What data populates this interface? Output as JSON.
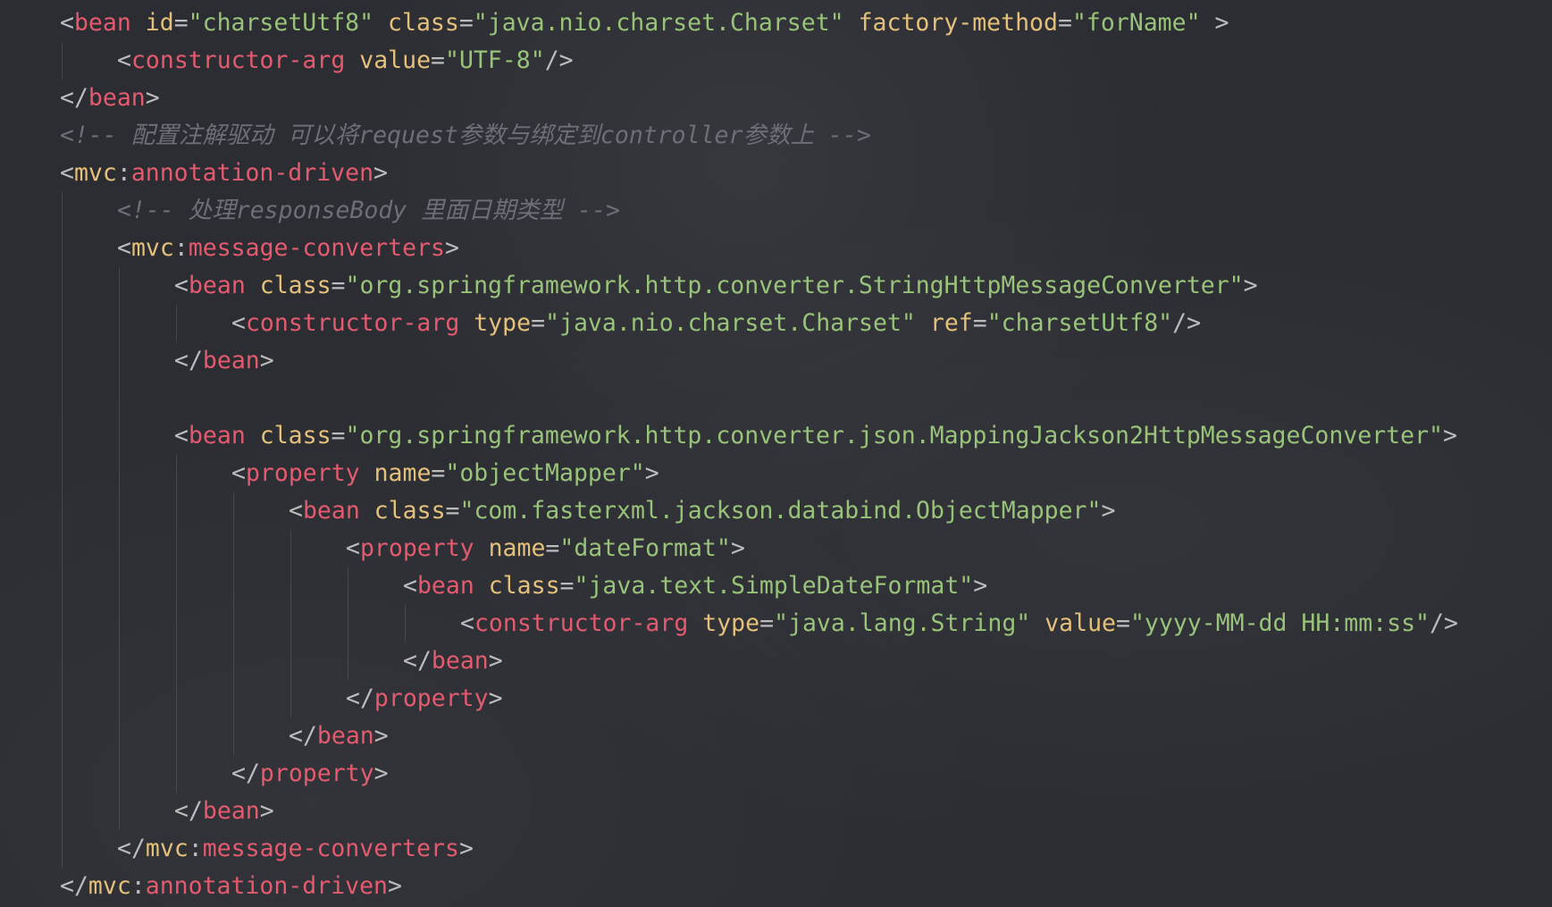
{
  "lines": [
    {
      "indent": 0,
      "tokens": [
        {
          "t": "bracket",
          "v": "<"
        },
        {
          "t": "tag",
          "v": "bean"
        },
        {
          "t": "text",
          "v": " "
        },
        {
          "t": "attr",
          "v": "id"
        },
        {
          "t": "eq",
          "v": "="
        },
        {
          "t": "value",
          "v": "\"charsetUtf8\""
        },
        {
          "t": "text",
          "v": " "
        },
        {
          "t": "attr",
          "v": "class"
        },
        {
          "t": "eq",
          "v": "="
        },
        {
          "t": "value",
          "v": "\"java.nio.charset.Charset\""
        },
        {
          "t": "text",
          "v": " "
        },
        {
          "t": "attr",
          "v": "factory-method"
        },
        {
          "t": "eq",
          "v": "="
        },
        {
          "t": "value",
          "v": "\"forName\""
        },
        {
          "t": "text",
          "v": " "
        },
        {
          "t": "bracket",
          "v": ">"
        }
      ]
    },
    {
      "indent": 1,
      "tokens": [
        {
          "t": "bracket",
          "v": "<"
        },
        {
          "t": "tag",
          "v": "constructor-arg"
        },
        {
          "t": "text",
          "v": " "
        },
        {
          "t": "attr",
          "v": "value"
        },
        {
          "t": "eq",
          "v": "="
        },
        {
          "t": "value",
          "v": "\"UTF-8\""
        },
        {
          "t": "bracket",
          "v": "/>"
        }
      ]
    },
    {
      "indent": 0,
      "tokens": [
        {
          "t": "bracket",
          "v": "</"
        },
        {
          "t": "tag",
          "v": "bean"
        },
        {
          "t": "bracket",
          "v": ">"
        }
      ]
    },
    {
      "indent": 0,
      "tokens": [
        {
          "t": "comment",
          "v": "<!-- 配置注解驱动 可以将request参数与绑定到controller参数上 -->"
        }
      ]
    },
    {
      "indent": 0,
      "tokens": [
        {
          "t": "bracket",
          "v": "<"
        },
        {
          "t": "ns",
          "v": "mvc"
        },
        {
          "t": "bracket",
          "v": ":"
        },
        {
          "t": "tag",
          "v": "annotation-driven"
        },
        {
          "t": "bracket",
          "v": ">"
        }
      ]
    },
    {
      "indent": 1,
      "tokens": [
        {
          "t": "comment",
          "v": "<!-- 处理responseBody 里面日期类型 -->"
        }
      ]
    },
    {
      "indent": 1,
      "tokens": [
        {
          "t": "bracket",
          "v": "<"
        },
        {
          "t": "ns",
          "v": "mvc"
        },
        {
          "t": "bracket",
          "v": ":"
        },
        {
          "t": "tag",
          "v": "message-converters"
        },
        {
          "t": "bracket",
          "v": ">"
        }
      ]
    },
    {
      "indent": 2,
      "tokens": [
        {
          "t": "bracket",
          "v": "<"
        },
        {
          "t": "tag",
          "v": "bean"
        },
        {
          "t": "text",
          "v": " "
        },
        {
          "t": "attr",
          "v": "class"
        },
        {
          "t": "eq",
          "v": "="
        },
        {
          "t": "value",
          "v": "\"org.springframework.http.converter.StringHttpMessageConverter\""
        },
        {
          "t": "bracket",
          "v": ">"
        }
      ]
    },
    {
      "indent": 3,
      "tokens": [
        {
          "t": "bracket",
          "v": "<"
        },
        {
          "t": "tag",
          "v": "constructor-arg"
        },
        {
          "t": "text",
          "v": " "
        },
        {
          "t": "attr",
          "v": "type"
        },
        {
          "t": "eq",
          "v": "="
        },
        {
          "t": "value",
          "v": "\"java.nio.charset.Charset\""
        },
        {
          "t": "text",
          "v": " "
        },
        {
          "t": "attr",
          "v": "ref"
        },
        {
          "t": "eq",
          "v": "="
        },
        {
          "t": "value",
          "v": "\"charsetUtf8\""
        },
        {
          "t": "bracket",
          "v": "/>"
        }
      ]
    },
    {
      "indent": 2,
      "tokens": [
        {
          "t": "bracket",
          "v": "</"
        },
        {
          "t": "tag",
          "v": "bean"
        },
        {
          "t": "bracket",
          "v": ">"
        }
      ]
    },
    {
      "indent": 0,
      "tokens": []
    },
    {
      "indent": 2,
      "tokens": [
        {
          "t": "bracket",
          "v": "<"
        },
        {
          "t": "tag",
          "v": "bean"
        },
        {
          "t": "text",
          "v": " "
        },
        {
          "t": "attr",
          "v": "class"
        },
        {
          "t": "eq",
          "v": "="
        },
        {
          "t": "value",
          "v": "\"org.springframework.http.converter.json.MappingJackson2HttpMessageConverter\""
        },
        {
          "t": "bracket",
          "v": ">"
        }
      ]
    },
    {
      "indent": 3,
      "tokens": [
        {
          "t": "bracket",
          "v": "<"
        },
        {
          "t": "tag",
          "v": "property"
        },
        {
          "t": "text",
          "v": " "
        },
        {
          "t": "attr",
          "v": "name"
        },
        {
          "t": "eq",
          "v": "="
        },
        {
          "t": "value",
          "v": "\"objectMapper\""
        },
        {
          "t": "bracket",
          "v": ">"
        }
      ]
    },
    {
      "indent": 4,
      "tokens": [
        {
          "t": "bracket",
          "v": "<"
        },
        {
          "t": "tag",
          "v": "bean"
        },
        {
          "t": "text",
          "v": " "
        },
        {
          "t": "attr",
          "v": "class"
        },
        {
          "t": "eq",
          "v": "="
        },
        {
          "t": "value",
          "v": "\"com.fasterxml.jackson.databind.ObjectMapper\""
        },
        {
          "t": "bracket",
          "v": ">"
        }
      ]
    },
    {
      "indent": 5,
      "tokens": [
        {
          "t": "bracket",
          "v": "<"
        },
        {
          "t": "tag",
          "v": "property"
        },
        {
          "t": "text",
          "v": " "
        },
        {
          "t": "attr",
          "v": "name"
        },
        {
          "t": "eq",
          "v": "="
        },
        {
          "t": "value",
          "v": "\"dateFormat\""
        },
        {
          "t": "bracket",
          "v": ">"
        }
      ]
    },
    {
      "indent": 6,
      "tokens": [
        {
          "t": "bracket",
          "v": "<"
        },
        {
          "t": "tag",
          "v": "bean"
        },
        {
          "t": "text",
          "v": " "
        },
        {
          "t": "attr",
          "v": "class"
        },
        {
          "t": "eq",
          "v": "="
        },
        {
          "t": "value",
          "v": "\"java.text.SimpleDateFormat\""
        },
        {
          "t": "bracket",
          "v": ">"
        }
      ]
    },
    {
      "indent": 7,
      "tokens": [
        {
          "t": "bracket",
          "v": "<"
        },
        {
          "t": "tag",
          "v": "constructor-arg"
        },
        {
          "t": "text",
          "v": " "
        },
        {
          "t": "attr",
          "v": "type"
        },
        {
          "t": "eq",
          "v": "="
        },
        {
          "t": "value",
          "v": "\"java.lang.String\""
        },
        {
          "t": "text",
          "v": " "
        },
        {
          "t": "attr",
          "v": "value"
        },
        {
          "t": "eq",
          "v": "="
        },
        {
          "t": "value",
          "v": "\"yyyy-MM-dd HH:mm:ss\""
        },
        {
          "t": "bracket",
          "v": "/>"
        }
      ]
    },
    {
      "indent": 6,
      "tokens": [
        {
          "t": "bracket",
          "v": "</"
        },
        {
          "t": "tag",
          "v": "bean"
        },
        {
          "t": "bracket",
          "v": ">"
        }
      ]
    },
    {
      "indent": 5,
      "tokens": [
        {
          "t": "bracket",
          "v": "</"
        },
        {
          "t": "tag",
          "v": "property"
        },
        {
          "t": "bracket",
          "v": ">"
        }
      ]
    },
    {
      "indent": 4,
      "tokens": [
        {
          "t": "bracket",
          "v": "</"
        },
        {
          "t": "tag",
          "v": "bean"
        },
        {
          "t": "bracket",
          "v": ">"
        }
      ]
    },
    {
      "indent": 3,
      "tokens": [
        {
          "t": "bracket",
          "v": "</"
        },
        {
          "t": "tag",
          "v": "property"
        },
        {
          "t": "bracket",
          "v": ">"
        }
      ]
    },
    {
      "indent": 2,
      "tokens": [
        {
          "t": "bracket",
          "v": "</"
        },
        {
          "t": "tag",
          "v": "bean"
        },
        {
          "t": "bracket",
          "v": ">"
        }
      ]
    },
    {
      "indent": 1,
      "tokens": [
        {
          "t": "bracket",
          "v": "</"
        },
        {
          "t": "ns",
          "v": "mvc"
        },
        {
          "t": "bracket",
          "v": ":"
        },
        {
          "t": "tag",
          "v": "message-converters"
        },
        {
          "t": "bracket",
          "v": ">"
        }
      ]
    },
    {
      "indent": 0,
      "tokens": [
        {
          "t": "bracket",
          "v": "</"
        },
        {
          "t": "ns",
          "v": "mvc"
        },
        {
          "t": "bracket",
          "v": ":"
        },
        {
          "t": "tag",
          "v": "annotation-driven"
        },
        {
          "t": "bracket",
          "v": ">"
        }
      ]
    }
  ]
}
